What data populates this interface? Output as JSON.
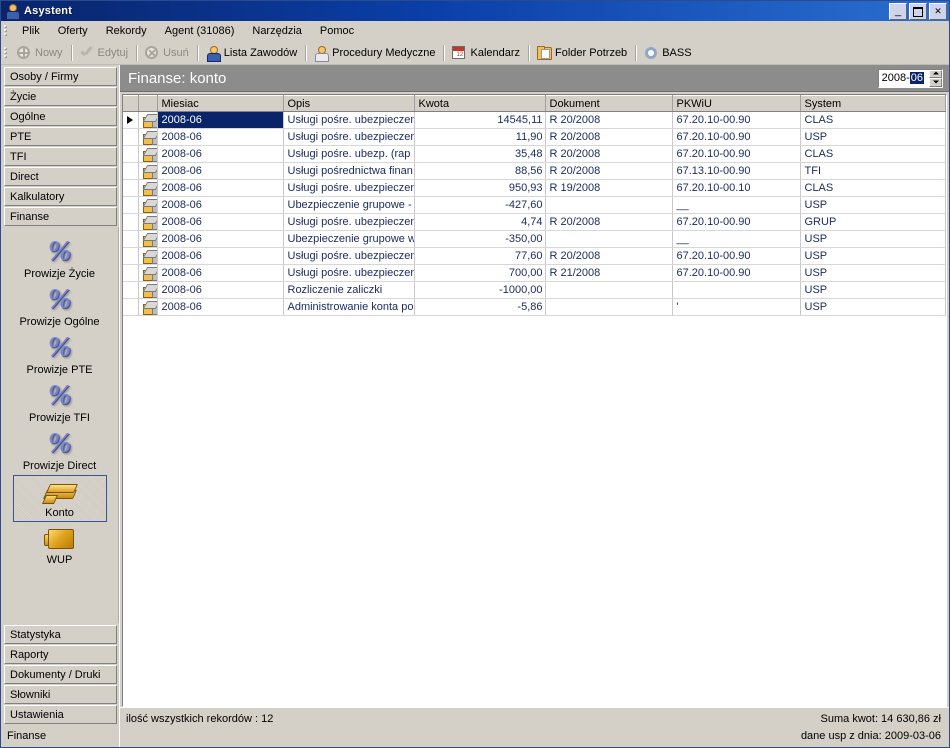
{
  "window": {
    "title": "Asystent",
    "icon": "user-icon",
    "buttons": {
      "minimize": "_",
      "maximize": "□",
      "close": "✕"
    }
  },
  "menu": {
    "items": [
      {
        "label": "Plik",
        "accel": "P"
      },
      {
        "label": "Oferty",
        "accel": "O"
      },
      {
        "label": "Rekordy",
        "accel": "R"
      },
      {
        "label": "Agent (31086)",
        "accel": ""
      },
      {
        "label": "Narzędzia",
        "accel": "N"
      },
      {
        "label": "Pomoc",
        "accel": "c"
      }
    ]
  },
  "toolbar": {
    "items": [
      {
        "label": "Nowy",
        "icon": "new-circle-plus-icon",
        "disabled": true
      },
      {
        "label": "Edytuj",
        "icon": "check-icon",
        "disabled": true
      },
      {
        "label": "Usuń",
        "icon": "delete-circle-x-icon",
        "disabled": true
      },
      {
        "label": "Lista Zawodów",
        "icon": "person-icon",
        "disabled": false
      },
      {
        "label": "Procedury Medyczne",
        "icon": "doctor-icon",
        "disabled": false
      },
      {
        "label": "Kalendarz",
        "icon": "calendar-icon",
        "disabled": false
      },
      {
        "label": "Folder Potrzeb",
        "icon": "folder-icon",
        "disabled": false
      },
      {
        "label": "BASS",
        "icon": "gear-icon",
        "disabled": false
      }
    ]
  },
  "sidebar": {
    "top_groups": [
      "Osoby / Firmy",
      "Życie",
      "Ogólne",
      "PTE",
      "TFI",
      "Direct",
      "Kalkulatory",
      "Finanse"
    ],
    "icons": [
      {
        "label": "Prowizje Życie",
        "icon": "percent-icon",
        "selected": false
      },
      {
        "label": "Prowizje Ogólne",
        "icon": "percent-icon",
        "selected": false
      },
      {
        "label": "Prowizje PTE",
        "icon": "percent-icon",
        "selected": false
      },
      {
        "label": "Prowizje TFI",
        "icon": "percent-icon",
        "selected": false
      },
      {
        "label": "Prowizje Direct",
        "icon": "percent-icon",
        "selected": false
      },
      {
        "label": "Konto",
        "icon": "money-stack-icon",
        "selected": true
      },
      {
        "label": "WUP",
        "icon": "gold-bar-icon",
        "selected": false
      }
    ],
    "bottom_groups": [
      "Statystyka",
      "Raporty",
      "Dokumenty / Druki",
      "Słowniki",
      "Ustawienia"
    ],
    "status": "Finanse"
  },
  "panel": {
    "title": "Finanse: konto",
    "period": {
      "prefix": "2008-",
      "selected_part": "06"
    }
  },
  "grid": {
    "columns": [
      "Miesiac",
      "Opis",
      "Kwota",
      "Dokument",
      "PKWiU",
      "System"
    ],
    "rows": [
      {
        "selected": true,
        "miesiac": "2008-06",
        "opis": "Usługi pośre. ubezpieczen",
        "kwota": "14545,11",
        "dokument": "R 20/2008",
        "pkwiu": "67.20.10-00.90",
        "system": "CLAS"
      },
      {
        "selected": false,
        "miesiac": "2008-06",
        "opis": "Usługi pośre. ubezpieczen",
        "kwota": "11,90",
        "dokument": "R 20/2008",
        "pkwiu": "67.20.10-00.90",
        "system": "USP"
      },
      {
        "selected": false,
        "miesiac": "2008-06",
        "opis": "Usługi pośre. ubezp. (rap",
        "kwota": "35,48",
        "dokument": "R 20/2008",
        "pkwiu": "67.20.10-00.90",
        "system": "CLAS"
      },
      {
        "selected": false,
        "miesiac": "2008-06",
        "opis": "Usługi pośrednictwa finan",
        "kwota": "88,56",
        "dokument": "R 20/2008",
        "pkwiu": "67.13.10-00.90",
        "system": "TFI"
      },
      {
        "selected": false,
        "miesiac": "2008-06",
        "opis": "Usługi pośre. ubezpieczen",
        "kwota": "950,93",
        "dokument": "R 19/2008",
        "pkwiu": "67.20.10-00.10",
        "system": "CLAS"
      },
      {
        "selected": false,
        "miesiac": "2008-06",
        "opis": "Ubezpieczenie grupowe -",
        "kwota": "-427,60",
        "dokument": "",
        "pkwiu": "__",
        "system": "USP"
      },
      {
        "selected": false,
        "miesiac": "2008-06",
        "opis": "Usługi pośre. ubezpieczen",
        "kwota": "4,74",
        "dokument": "R 20/2008",
        "pkwiu": "67.20.10-00.90",
        "system": "GRUP"
      },
      {
        "selected": false,
        "miesiac": "2008-06",
        "opis": "Ubezpieczenie grupowe w",
        "kwota": "-350,00",
        "dokument": "",
        "pkwiu": "__",
        "system": "USP"
      },
      {
        "selected": false,
        "miesiac": "2008-06",
        "opis": "Usługi pośre. ubezpieczen",
        "kwota": "77,60",
        "dokument": "R 20/2008",
        "pkwiu": "67.20.10-00.90",
        "system": "USP"
      },
      {
        "selected": false,
        "miesiac": "2008-06",
        "opis": "Usługi pośre. ubezpieczen",
        "kwota": "700,00",
        "dokument": "R 21/2008",
        "pkwiu": "67.20.10-00.90",
        "system": "USP"
      },
      {
        "selected": false,
        "miesiac": "2008-06",
        "opis": "Rozliczenie zaliczki",
        "kwota": "-1000,00",
        "dokument": "",
        "pkwiu": "",
        "system": "USP"
      },
      {
        "selected": false,
        "miesiac": "2008-06",
        "opis": "Administrowanie konta po",
        "kwota": "-5,86",
        "dokument": "",
        "pkwiu": "'",
        "system": "USP"
      }
    ]
  },
  "statusbar": {
    "records": "ilość wszystkich rekordów : 12",
    "sum": "Suma kwot: 14 630,86 zł",
    "data_date": "dane usp z dnia: 2009-03-06"
  },
  "colors": {
    "title_bar": "#0a246a",
    "panel_header": "#8c8c8c",
    "selection": "#0a246a",
    "face": "#d4d0c8",
    "grid_text": "#1a2a5e"
  }
}
